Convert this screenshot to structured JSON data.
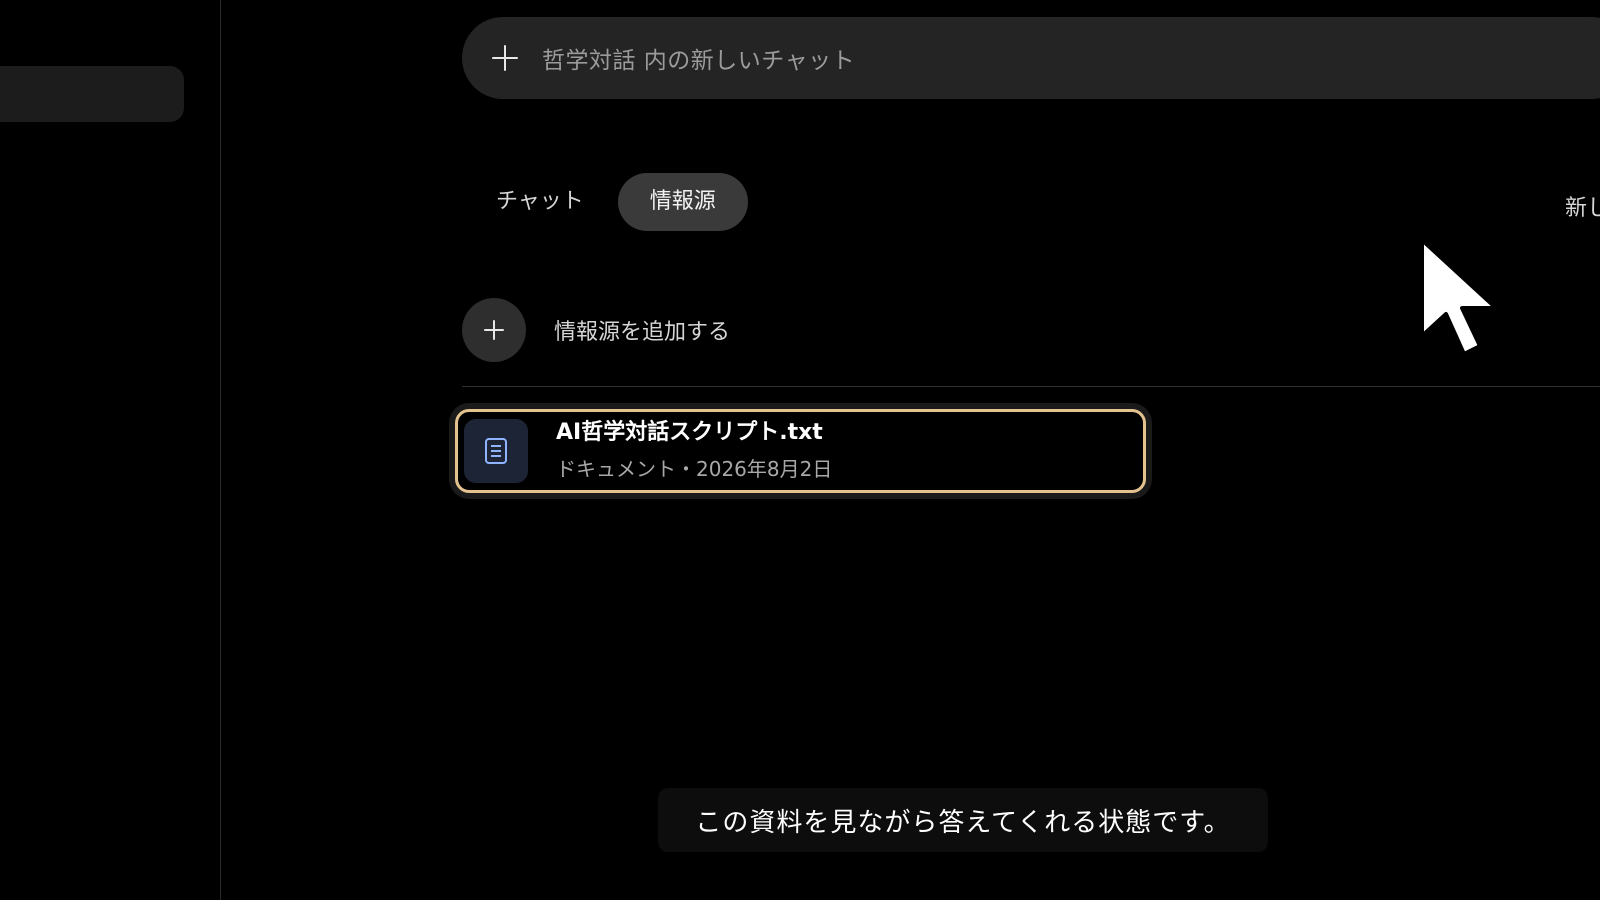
{
  "new_chat": {
    "placeholder": "哲学対話 内の新しいチャット",
    "icon": "plus-icon"
  },
  "tabs": [
    {
      "label": "チャット",
      "active": false
    },
    {
      "label": "情報源",
      "active": true
    }
  ],
  "header_right_label": "新し",
  "add_source": {
    "label": "情報源を追加する",
    "icon": "plus-icon"
  },
  "sources": [
    {
      "title": "AI哲学対話スクリプト.txt",
      "meta": "ドキュメント・2026年8月2日",
      "icon": "document-icon",
      "selected": true
    }
  ],
  "caption": "この資料を見ながら答えてくれる状態です。",
  "colors": {
    "background": "#000000",
    "surface": "#242424",
    "active_tab": "#3a3a3a",
    "highlight_border": "#e3c28e",
    "doc_icon_tile": "#1d2436",
    "doc_icon_stroke": "#8fb3ff"
  }
}
